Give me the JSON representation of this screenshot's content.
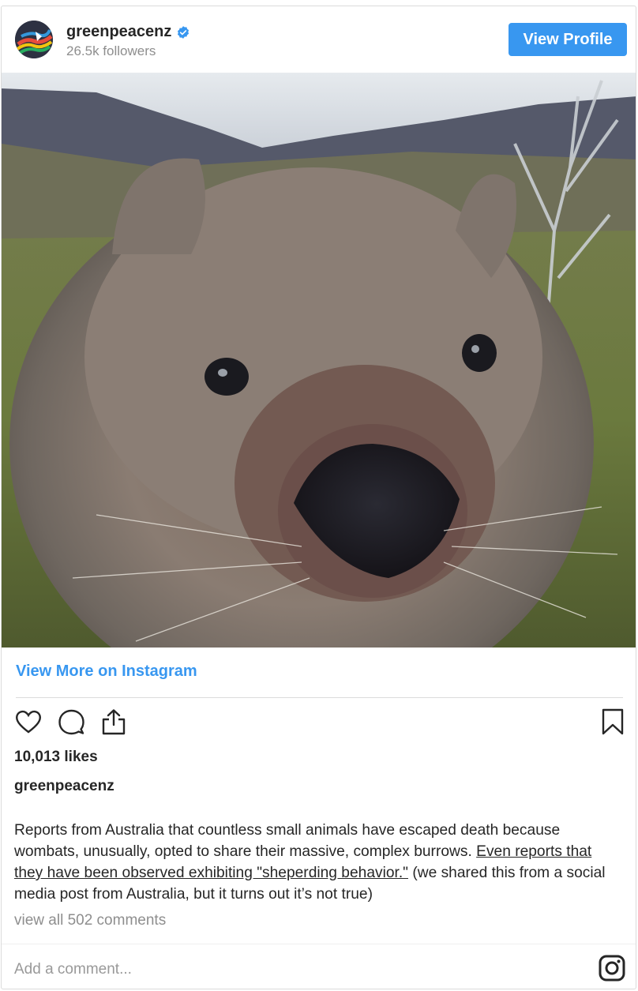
{
  "header": {
    "username": "greenpeacenz",
    "followers": "26.5k followers",
    "view_profile_label": "View Profile"
  },
  "colors": {
    "accent": "#3897f0",
    "text": "#262626",
    "muted": "#8e8e8e",
    "border": "#dbdbdb"
  },
  "post": {
    "image_subject": "close-up photo of a wombat in a grassy field",
    "view_more_label": "View More on Instagram",
    "likes": "10,013 likes",
    "owner": "greenpeacenz",
    "caption_plain": "Reports from Australia that countless small animals have escaped death because wombats, unusually, opted to share their massive, complex burrows.",
    "caption_struck": "Even reports that they have been observed exhibiting \"sheperding behavior.\"",
    "caption_tail": "(we shared this from a social media post from Australia, but it turns out it’s not true)",
    "view_comments_label": "view all 502 comments",
    "add_comment_placeholder": "Add a comment..."
  },
  "icons": {
    "verified": "verified-badge-icon",
    "like": "heart-icon",
    "comment": "comment-bubble-icon",
    "share": "share-upload-icon",
    "save": "bookmark-icon",
    "instagram": "instagram-logo-icon"
  }
}
